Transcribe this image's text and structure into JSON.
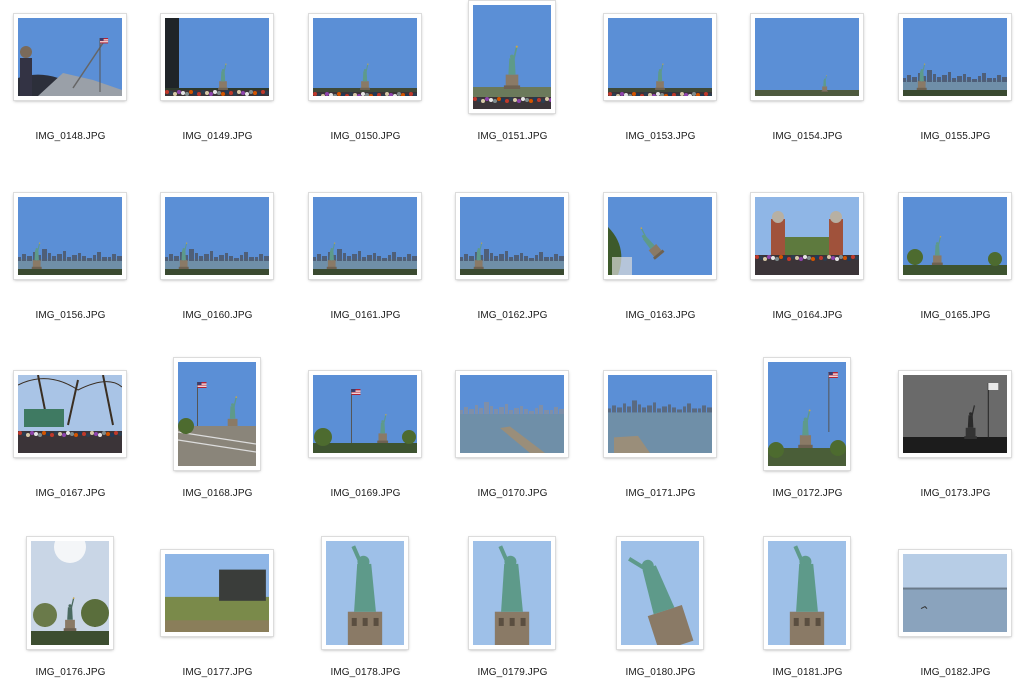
{
  "window": {
    "title": ""
  },
  "photos": [
    {
      "name": "IMG_0148.JPG",
      "orientation": "landscape",
      "scene": "boat-crowd-flag"
    },
    {
      "name": "IMG_0149.JPG",
      "orientation": "landscape",
      "scene": "statue-distant-pole"
    },
    {
      "name": "IMG_0150.JPG",
      "orientation": "landscape",
      "scene": "statue-distant"
    },
    {
      "name": "IMG_0151.JPG",
      "orientation": "portrait",
      "scene": "statue-crowd"
    },
    {
      "name": "IMG_0153.JPG",
      "orientation": "landscape",
      "scene": "statue-distant"
    },
    {
      "name": "IMG_0154.JPG",
      "orientation": "landscape",
      "scene": "statue-small"
    },
    {
      "name": "IMG_0155.JPG",
      "orientation": "landscape",
      "scene": "statue-skyline"
    },
    {
      "name": "IMG_0156.JPG",
      "orientation": "landscape",
      "scene": "statue-skyline"
    },
    {
      "name": "IMG_0160.JPG",
      "orientation": "landscape",
      "scene": "statue-skyline"
    },
    {
      "name": "IMG_0161.JPG",
      "orientation": "landscape",
      "scene": "statue-skyline"
    },
    {
      "name": "IMG_0162.JPG",
      "orientation": "landscape",
      "scene": "statue-skyline"
    },
    {
      "name": "IMG_0163.JPG",
      "orientation": "landscape",
      "scene": "statue-tilted"
    },
    {
      "name": "IMG_0164.JPG",
      "orientation": "landscape",
      "scene": "gate-crowd"
    },
    {
      "name": "IMG_0165.JPG",
      "orientation": "landscape",
      "scene": "statue-trees"
    },
    {
      "name": "IMG_0167.JPG",
      "orientation": "landscape",
      "scene": "trees-crowd"
    },
    {
      "name": "IMG_0168.JPG",
      "orientation": "portrait",
      "scene": "statue-flag-railing"
    },
    {
      "name": "IMG_0169.JPG",
      "orientation": "landscape",
      "scene": "statue-flag-trees"
    },
    {
      "name": "IMG_0170.JPG",
      "orientation": "landscape",
      "scene": "pier-water"
    },
    {
      "name": "IMG_0171.JPG",
      "orientation": "landscape",
      "scene": "pier-skyline"
    },
    {
      "name": "IMG_0172.JPG",
      "orientation": "portrait",
      "scene": "statue-flag"
    },
    {
      "name": "IMG_0173.JPG",
      "orientation": "landscape",
      "scene": "statue-bw"
    },
    {
      "name": "IMG_0176.JPG",
      "orientation": "portrait",
      "scene": "statue-haze-trees"
    },
    {
      "name": "IMG_0177.JPG",
      "orientation": "landscape",
      "scene": "fort-grass"
    },
    {
      "name": "IMG_0178.JPG",
      "orientation": "portrait",
      "scene": "statue-closeup"
    },
    {
      "name": "IMG_0179.JPG",
      "orientation": "portrait",
      "scene": "statue-closeup"
    },
    {
      "name": "IMG_0180.JPG",
      "orientation": "portrait",
      "scene": "statue-closeup-tilted"
    },
    {
      "name": "IMG_0181.JPG",
      "orientation": "portrait",
      "scene": "statue-closeup"
    },
    {
      "name": "IMG_0182.JPG",
      "orientation": "landscape",
      "scene": "harbor-water"
    }
  ],
  "colors": {
    "sky": "#5b8fd6",
    "sky_light": "#8fb6e6",
    "copper": "#5e9a8a",
    "pedestal": "#8a7a66",
    "water": "#6f8fa8",
    "grass": "#7a8a4a"
  }
}
